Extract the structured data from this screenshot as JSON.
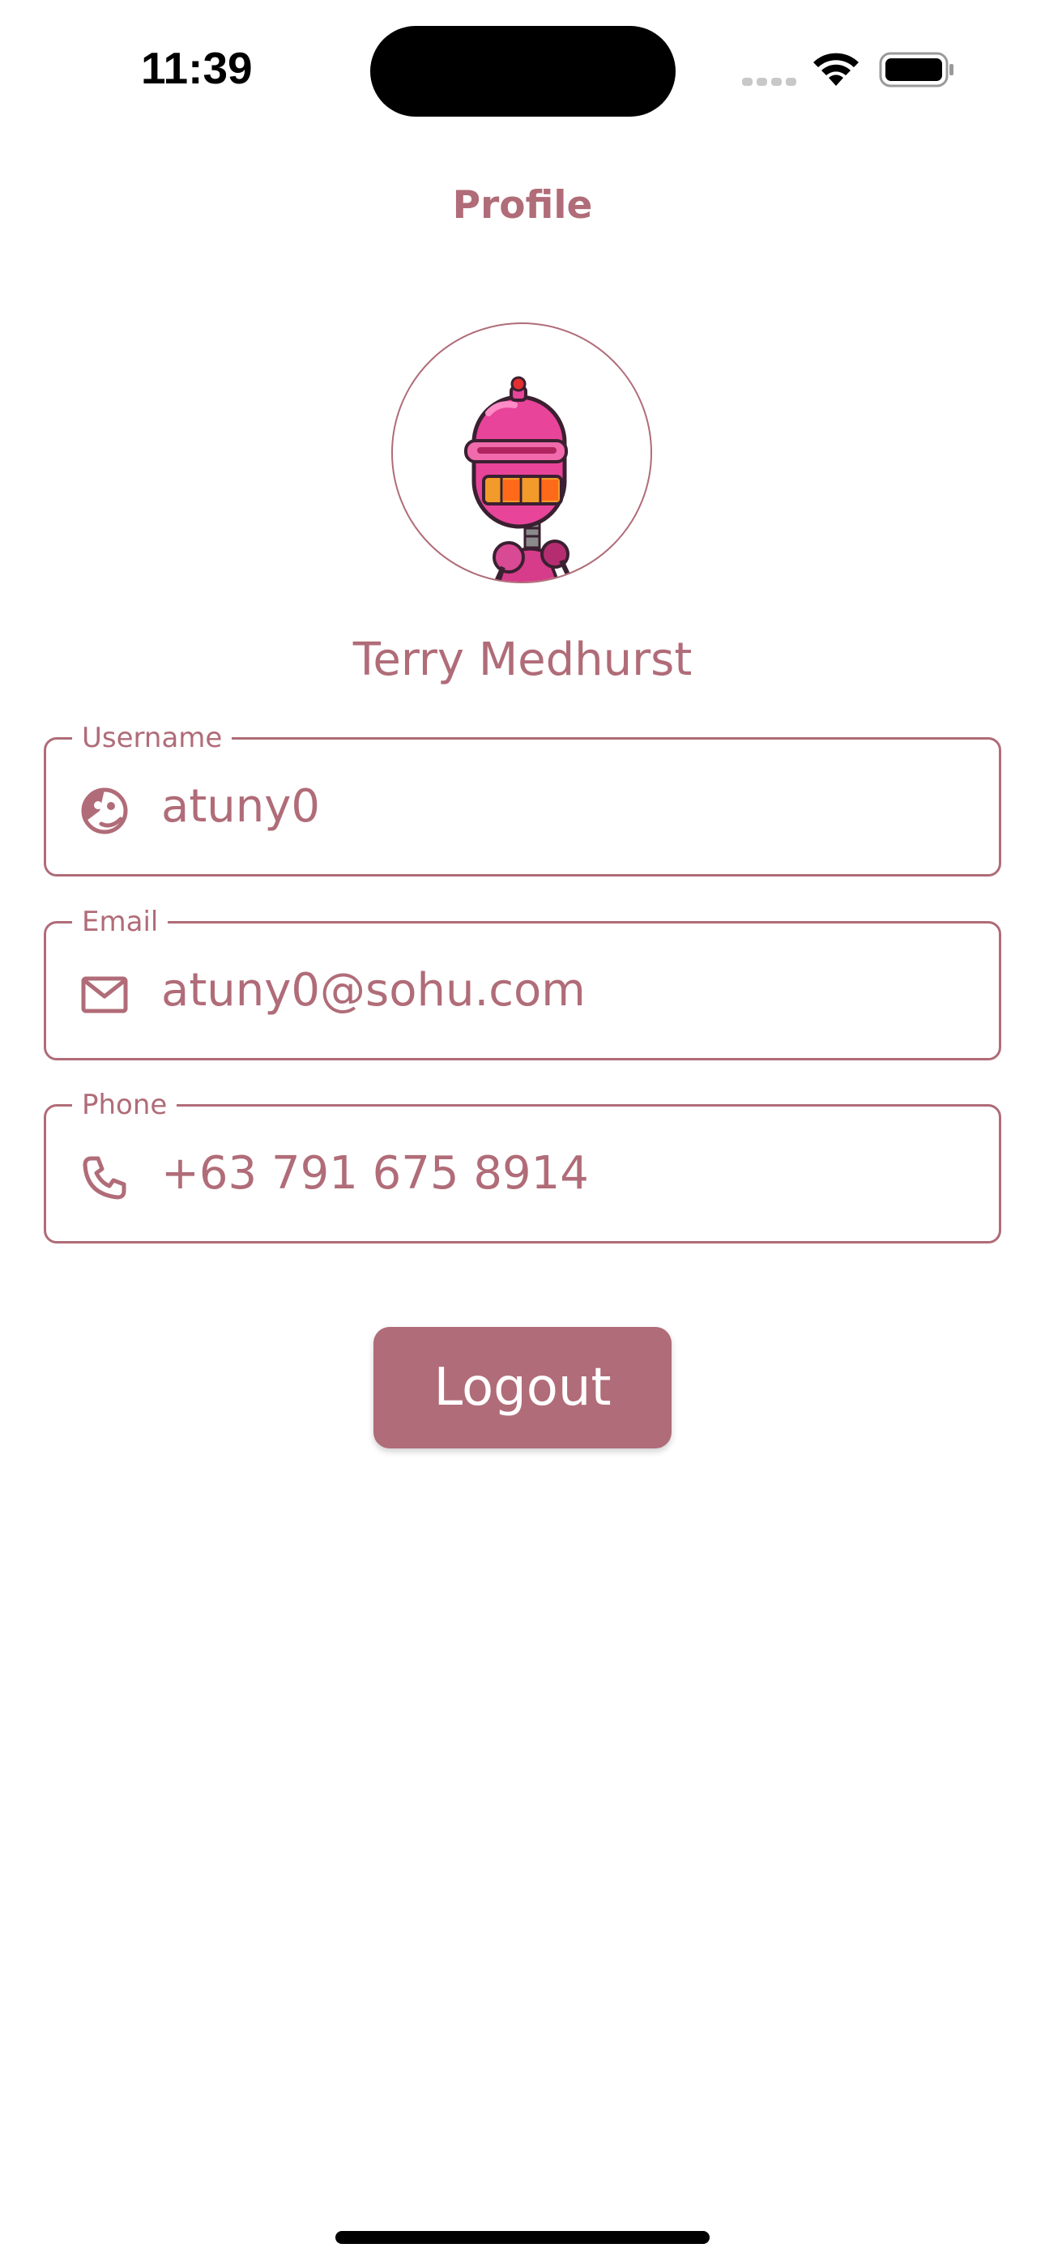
{
  "status_bar": {
    "time": "11:39",
    "icons": [
      "signal-icon",
      "wifi-icon",
      "battery-icon"
    ]
  },
  "header": {
    "title": "Profile"
  },
  "profile": {
    "avatar_icon": "robot-avatar",
    "name": "Terry Medhurst"
  },
  "fields": {
    "username": {
      "label": "Username",
      "value": "atuny0",
      "icon": "face-icon"
    },
    "email": {
      "label": "Email",
      "value": "atuny0@sohu.com",
      "icon": "mail-icon"
    },
    "phone": {
      "label": "Phone",
      "value": "+63 791 675 8914",
      "icon": "phone-icon"
    }
  },
  "actions": {
    "logout_label": "Logout"
  },
  "colors": {
    "accent": "#b06c78",
    "background": "#ffffff"
  }
}
